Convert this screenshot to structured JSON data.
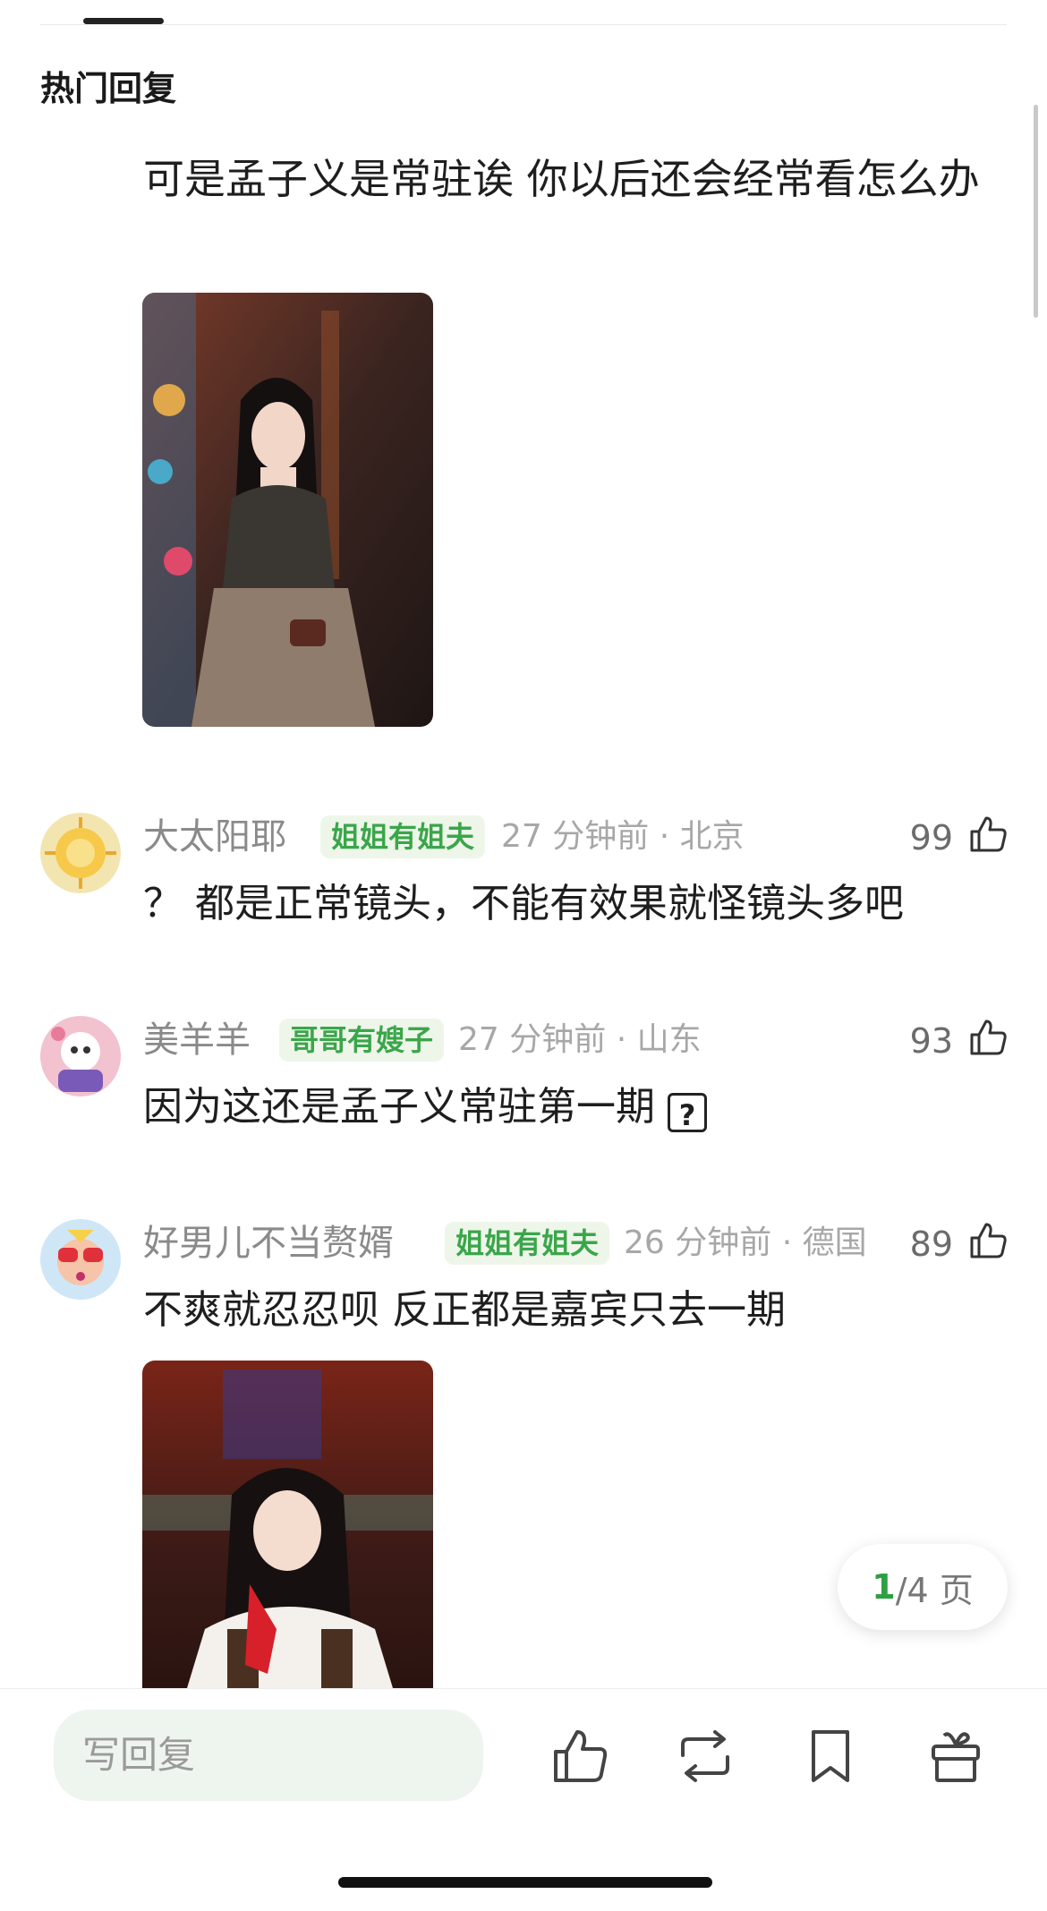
{
  "header": {
    "section_title": "热门回复"
  },
  "first_reply": {
    "text": "可是孟子义是常驻诶 你以后还会经常看怎么办"
  },
  "comments": [
    {
      "username": "大太阳耶",
      "badge": "姐姐有姐夫",
      "time_location": "27 分钟前 · 北京",
      "likes": "99",
      "text": "？ 都是正常镜头，不能有效果就怪镜头多吧"
    },
    {
      "username": "美羊羊",
      "badge": "哥哥有嫂子",
      "time_location": "27 分钟前 · 山东",
      "likes": "93",
      "text": "因为这还是孟子义常驻第一期"
    },
    {
      "username": "好男儿不当赘婿",
      "badge": "姐姐有姐夫",
      "time_location": "26 分钟前 · 德国",
      "likes": "89",
      "text": "不爽就忍忍呗 反正都是嘉宾只去一期"
    }
  ],
  "pager": {
    "current": "1",
    "total_suffix": "/4 页"
  },
  "bottom_bar": {
    "reply_placeholder": "写回复"
  },
  "colors": {
    "accent_green": "#2ea043",
    "badge_bg": "#eef6ea",
    "input_bg": "#eef5ee"
  }
}
